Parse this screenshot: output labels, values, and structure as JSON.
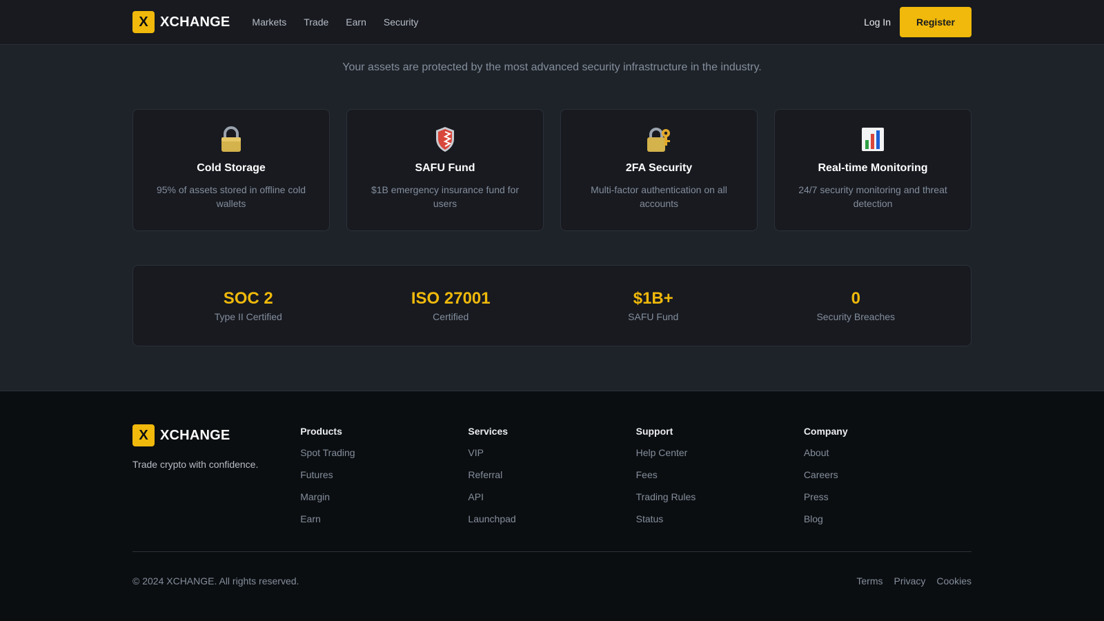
{
  "brand": {
    "mark": "X",
    "name": "XCHANGE"
  },
  "nav": [
    {
      "label": "Markets"
    },
    {
      "label": "Trade"
    },
    {
      "label": "Earn"
    },
    {
      "label": "Security"
    }
  ],
  "auth": {
    "login": "Log In",
    "register": "Register"
  },
  "hero": {
    "subtitle": "Your assets are protected by the most advanced security infrastructure in the industry."
  },
  "features": [
    {
      "icon": "lock-icon",
      "title": "Cold Storage",
      "desc": "95% of assets stored in offline cold wallets"
    },
    {
      "icon": "shield-icon",
      "title": "SAFU Fund",
      "desc": "$1B emergency insurance fund for users"
    },
    {
      "icon": "lock-with-key-icon",
      "title": "2FA Security",
      "desc": "Multi-factor authentication on all accounts"
    },
    {
      "icon": "bar-chart-icon",
      "title": "Real-time Monitoring",
      "desc": "24/7 security monitoring and threat detection"
    }
  ],
  "stats": [
    {
      "value": "SOC 2",
      "label": "Type II Certified"
    },
    {
      "value": "ISO 27001",
      "label": "Certified"
    },
    {
      "value": "$1B+",
      "label": "SAFU Fund"
    },
    {
      "value": "0",
      "label": "Security Breaches"
    }
  ],
  "footer": {
    "tagline": "Trade crypto with confidence.",
    "columns": [
      {
        "title": "Products",
        "links": [
          "Spot Trading",
          "Futures",
          "Margin",
          "Earn"
        ]
      },
      {
        "title": "Services",
        "links": [
          "VIP",
          "Referral",
          "API",
          "Launchpad"
        ]
      },
      {
        "title": "Support",
        "links": [
          "Help Center",
          "Fees",
          "Trading Rules",
          "Status"
        ]
      },
      {
        "title": "Company",
        "links": [
          "About",
          "Careers",
          "Press",
          "Blog"
        ]
      }
    ],
    "copyright": "© 2024 XCHANGE. All rights reserved.",
    "legal": [
      "Terms",
      "Privacy",
      "Cookies"
    ]
  },
  "colors": {
    "accent": "#f0b90b",
    "background": "#1e2329",
    "card": "#181a20",
    "footer": "#0b0e11"
  }
}
